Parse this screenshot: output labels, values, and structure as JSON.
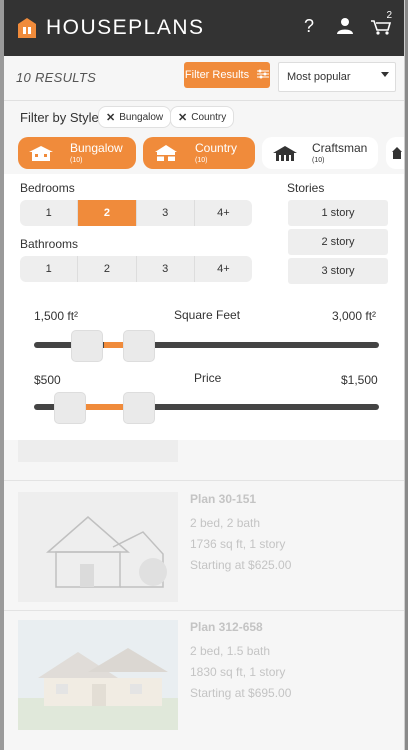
{
  "header": {
    "brand": "HOUSEPLANS",
    "help_icon": "?",
    "cart_count": "2"
  },
  "results": {
    "count": "10 RESULTS",
    "filter_button": "Filter Results",
    "sort_selected": "Most popular"
  },
  "style_filter": {
    "label": "Filter by Style",
    "chips": [
      "Bungalow",
      "Country"
    ],
    "cards": [
      {
        "name": "Bungalow",
        "count": "(10)",
        "active": true
      },
      {
        "name": "Country",
        "count": "(10)",
        "active": true
      },
      {
        "name": "Craftsman",
        "count": "(10)",
        "active": false
      }
    ]
  },
  "filters": {
    "bedrooms_label": "Bedrooms",
    "bedrooms": [
      "1",
      "2",
      "3",
      "4+"
    ],
    "bedrooms_selected": "2",
    "bathrooms_label": "Bathrooms",
    "bathrooms": [
      "1",
      "2",
      "3",
      "4+"
    ],
    "stories_label": "Stories",
    "stories": [
      "1 story",
      "2 story",
      "3 story"
    ],
    "sqft": {
      "label": "Square Feet",
      "min_label": "1,500 ft²",
      "max_label": "3,000 ft²"
    },
    "price": {
      "label": "Price",
      "min_label": "$500",
      "max_label": "$1,500"
    }
  },
  "listings": [
    {
      "title": "Plan 30-151",
      "beds": "2 bed, 2 bath",
      "size": "1736 sq ft, 1 story",
      "price": "Starting at $625.00"
    },
    {
      "title": "Plan 312-658",
      "beds": "2 bed, 1.5 bath",
      "size": "1830 sq ft, 1 story",
      "price": "Starting at $695.00"
    }
  ],
  "colors": {
    "accent": "#f08b3b",
    "header": "#333333"
  }
}
